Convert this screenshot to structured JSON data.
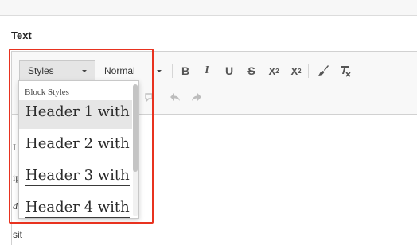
{
  "field": {
    "label": "Text"
  },
  "toolbar": {
    "styles_label": "Styles",
    "format_label": "Normal",
    "bold_label": "B",
    "italic_label": "I",
    "underline_label": "U",
    "strike_label": "S",
    "subscript_label": "X",
    "subscript_mark": "2",
    "superscript_label": "X",
    "superscript_mark": "2"
  },
  "styles_dropdown": {
    "header": "Block Styles",
    "items": [
      {
        "label": "Header 1 with"
      },
      {
        "label": "Header 2 with"
      },
      {
        "label": "Header 3 with"
      },
      {
        "label": "Header 4 with"
      }
    ]
  },
  "content": {
    "lines": [
      "La",
      "ip",
      "d",
      "sit"
    ]
  },
  "colors": {
    "highlight": "#e8321f",
    "toolbar_bg": "#f8f8f8",
    "active_item": "#e6e6e6"
  }
}
